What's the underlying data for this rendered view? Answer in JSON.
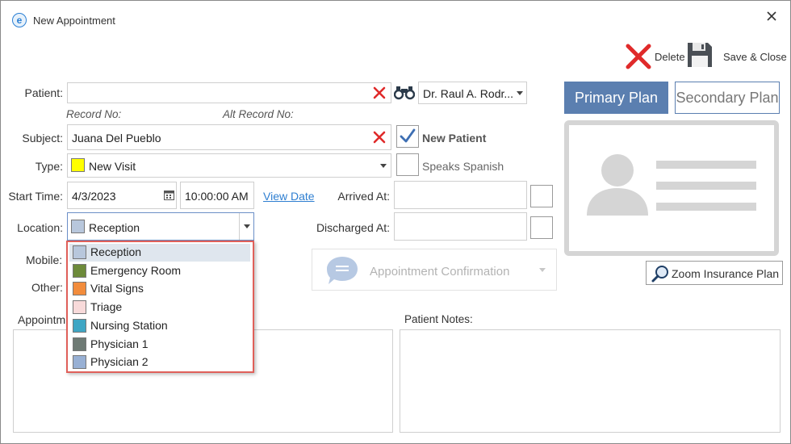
{
  "window": {
    "title": "New Appointment"
  },
  "toolbar": {
    "delete_label": "Delete",
    "save_close_label": "Save & Close"
  },
  "labels": {
    "patient": "Patient:",
    "record_no": "Record No:",
    "alt_record_no": "Alt Record No:",
    "subject": "Subject:",
    "type": "Type:",
    "start_time": "Start Time:",
    "location": "Location:",
    "mobile": "Mobile:",
    "other": "Other:",
    "appointment_notes": "Appointm",
    "patient_notes": "Patient Notes:",
    "arrived_at": "Arrived At:",
    "discharged_at": "Discharged At:"
  },
  "form": {
    "patient_value": "",
    "doctor": "Dr. Raul A. Rodr...",
    "subject_value": "Juana Del Pueblo",
    "new_patient": {
      "label": "New Patient",
      "checked": true
    },
    "speaks_spanish": {
      "label": "Speaks Spanish",
      "checked": false
    },
    "type": {
      "value": "New Visit",
      "color": "#ffff00"
    },
    "start_date": "4/3/2023",
    "start_time": "10:00:00 AM",
    "view_date_link": "View Date",
    "location": {
      "value": "Reception",
      "color": "#b8c7dc"
    }
  },
  "plans": {
    "primary": "Primary Plan",
    "secondary": "Secondary Plan"
  },
  "zoom_insurance_label": "Zoom Insurance Plan",
  "appointment_confirmation_label": "Appointment Confirmation",
  "location_options": [
    {
      "label": "Reception",
      "color": "#b8c7dc",
      "selected": true
    },
    {
      "label": "Emergency Room",
      "color": "#6d8a3a",
      "selected": false
    },
    {
      "label": "Vital Signs",
      "color": "#f28c3c",
      "selected": false
    },
    {
      "label": "Triage",
      "color": "#f8dada",
      "selected": false
    },
    {
      "label": "Nursing Station",
      "color": "#3fa6c4",
      "selected": false
    },
    {
      "label": "Physician 1",
      "color": "#6e7a74",
      "selected": false
    },
    {
      "label": "Physician 2",
      "color": "#98b0d4",
      "selected": false
    }
  ],
  "colors": {
    "accent": "#5b7fb0",
    "link": "#2f7fd1",
    "dropdown_border": "#e0605a",
    "delete_red": "#e02a2a"
  }
}
